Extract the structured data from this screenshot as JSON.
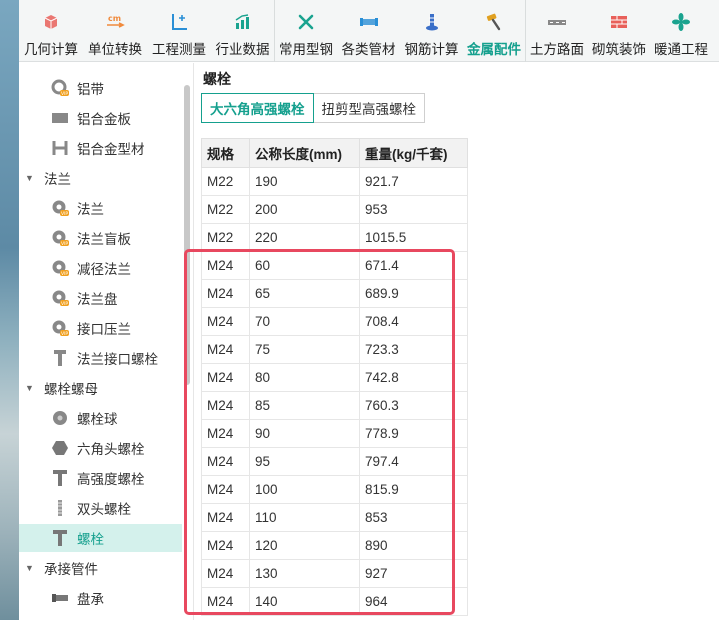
{
  "toolbar": {
    "items": [
      {
        "label": "几何计算",
        "icon": "cube-icon",
        "color": "#e8605a"
      },
      {
        "label": "单位转换",
        "icon": "cm-convert-icon",
        "color": "#f08a3c"
      },
      {
        "label": "工程测量",
        "icon": "axis-icon",
        "color": "#2a8fd6"
      },
      {
        "label": "行业数据",
        "icon": "bar-chart-icon",
        "color": "#1aa38f"
      },
      {
        "label": "常用型钢",
        "icon": "tools-icon",
        "color": "#1aa38f"
      },
      {
        "label": "各类管材",
        "icon": "pipe-icon",
        "color": "#2a8fd6"
      },
      {
        "label": "钢筋计算",
        "icon": "rebar-icon",
        "color": "#3a6fc8"
      },
      {
        "label": "金属配件",
        "icon": "hammer-icon",
        "color": "#e0a020",
        "active": true
      },
      {
        "label": "土方路面",
        "icon": "road-icon",
        "color": "#888888"
      },
      {
        "label": "砌筑装饰",
        "icon": "brick-icon",
        "color": "#e8605a"
      },
      {
        "label": "暖通工程",
        "icon": "fan-icon",
        "color": "#1aa38f"
      }
    ]
  },
  "sidebar": {
    "rows": [
      {
        "type": "leaf",
        "label": "铝带",
        "icon": "ring-vip-icon"
      },
      {
        "type": "leaf",
        "label": "铝合金板",
        "icon": "plate-icon"
      },
      {
        "type": "leaf",
        "label": "铝合金型材",
        "icon": "h-beam-icon"
      },
      {
        "type": "group",
        "label": "法兰"
      },
      {
        "type": "leaf",
        "label": "法兰",
        "icon": "flange-vip-icon"
      },
      {
        "type": "leaf",
        "label": "法兰盲板",
        "icon": "flange-vip-icon"
      },
      {
        "type": "leaf",
        "label": "减径法兰",
        "icon": "flange-vip-icon"
      },
      {
        "type": "leaf",
        "label": "法兰盘",
        "icon": "flange-vip-icon"
      },
      {
        "type": "leaf",
        "label": "接口压兰",
        "icon": "flange-vip-icon"
      },
      {
        "type": "leaf",
        "label": "法兰接口螺栓",
        "icon": "bolt-icon"
      },
      {
        "type": "group",
        "label": "螺栓螺母"
      },
      {
        "type": "leaf",
        "label": "螺栓球",
        "icon": "ball-icon"
      },
      {
        "type": "leaf",
        "label": "六角头螺栓",
        "icon": "hex-icon"
      },
      {
        "type": "leaf",
        "label": "高强度螺栓",
        "icon": "t-bolt-icon"
      },
      {
        "type": "leaf",
        "label": "双头螺栓",
        "icon": "stud-icon"
      },
      {
        "type": "leaf",
        "label": "螺栓",
        "icon": "t-bolt-icon",
        "selected": true
      },
      {
        "type": "group",
        "label": "承接管件"
      },
      {
        "type": "leaf",
        "label": "盘承",
        "icon": "pipe-fitting-icon"
      }
    ]
  },
  "main": {
    "section_title": "螺栓",
    "tabs": [
      {
        "label": "大六角高强螺栓",
        "active": true
      },
      {
        "label": "扭剪型高强螺栓",
        "active": false
      }
    ],
    "table": {
      "headers": [
        "规格",
        "公称长度(mm)",
        "重量(kg/千套)"
      ],
      "rows": [
        [
          "M22",
          "190",
          "921.7"
        ],
        [
          "M22",
          "200",
          "953"
        ],
        [
          "M22",
          "220",
          "1015.5"
        ],
        [
          "M24",
          "60",
          "671.4"
        ],
        [
          "M24",
          "65",
          "689.9"
        ],
        [
          "M24",
          "70",
          "708.4"
        ],
        [
          "M24",
          "75",
          "723.3"
        ],
        [
          "M24",
          "80",
          "742.8"
        ],
        [
          "M24",
          "85",
          "760.3"
        ],
        [
          "M24",
          "90",
          "778.9"
        ],
        [
          "M24",
          "95",
          "797.4"
        ],
        [
          "M24",
          "100",
          "815.9"
        ],
        [
          "M24",
          "110",
          "853"
        ],
        [
          "M24",
          "120",
          "890"
        ],
        [
          "M24",
          "130",
          "927"
        ],
        [
          "M24",
          "140",
          "964"
        ]
      ]
    }
  },
  "colors": {
    "accent": "#15a08e",
    "highlight": "#e8485f"
  }
}
